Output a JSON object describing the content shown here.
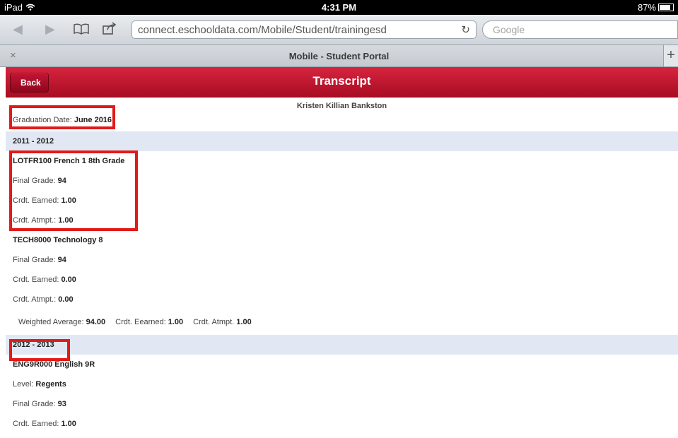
{
  "statusbar": {
    "device": "iPad",
    "time": "4:31 PM",
    "battery": "87%"
  },
  "browser": {
    "url": "connect.eschooldata.com/Mobile/Student/trainingesd",
    "search_placeholder": "Google",
    "tab_title": "Mobile - Student Portal",
    "tab_close": "×",
    "tab_plus": "+"
  },
  "app": {
    "back_label": "Back",
    "title": "Transcript",
    "student_name": "Kristen Killian Bankston",
    "graduation_label": "Graduation Date: ",
    "graduation_value": "June 2016"
  },
  "years": [
    {
      "label": "2011 - 2012",
      "courses": [
        {
          "title": "LOTFR100 French 1 8th Grade",
          "fields": [
            {
              "label": "Final Grade: ",
              "value": "94"
            },
            {
              "label": "Crdt. Earned: ",
              "value": "1.00"
            },
            {
              "label": "Crdt. Atmpt.: ",
              "value": "1.00"
            }
          ]
        },
        {
          "title": "TECH8000 Technology 8",
          "fields": [
            {
              "label": "Final Grade: ",
              "value": "94"
            },
            {
              "label": "Crdt. Earned: ",
              "value": "0.00"
            },
            {
              "label": "Crdt. Atmpt.: ",
              "value": "0.00"
            }
          ]
        }
      ],
      "summary": {
        "wavg_label": "Weighted Average: ",
        "wavg_value": "94.00",
        "earned_label": "Crdt. Eearned: ",
        "earned_value": "1.00",
        "atmpt_label": "Crdt. Atmpt. ",
        "atmpt_value": "1.00"
      }
    },
    {
      "label": "2012 - 2013",
      "courses": [
        {
          "title": "ENG9R000 English 9R",
          "fields": [
            {
              "label": "Level: ",
              "value": "Regents"
            },
            {
              "label": "Final Grade: ",
              "value": "93"
            },
            {
              "label": "Crdt. Earned: ",
              "value": "1.00"
            }
          ]
        }
      ]
    }
  ],
  "colors": {
    "header_red": "#c0142f",
    "year_band": "#e2e8f3",
    "highlight": "#e11a1a"
  }
}
